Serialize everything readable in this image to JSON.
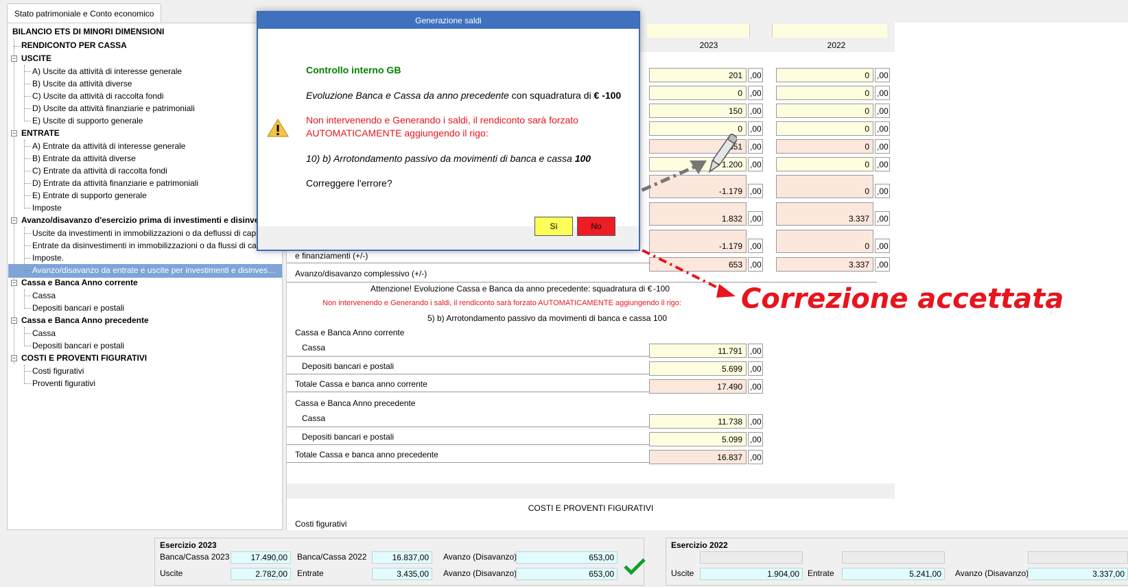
{
  "tab": {
    "label": "Stato patrimoniale e Conto economico"
  },
  "tree": {
    "root": "BILANCIO ETS DI MINORI DIMENSIONI",
    "rendiconto": "RENDICONTO PER CASSA",
    "uscite": "USCITE",
    "uscite_items": [
      "A) Uscite da attività di interesse generale",
      "B) Uscite da attività diverse",
      "C) Uscite da attività di raccolta fondi",
      "D) Uscite da attività finanziarie e patrimoniali",
      "E) Uscite di supporto generale"
    ],
    "entrate": "ENTRATE",
    "entrate_items": [
      "A) Entrate da attività di interesse generale",
      "B) Entrate da attività diverse",
      "C) Entrate da attività di raccolta fondi",
      "D) Entrate da attività finanziarie e patrimoniali",
      "E) Entrate di supporto generale",
      "Imposte"
    ],
    "avanzo": "Avanzo/disavanzo d'esercizio prima di investimenti e disinvestimenti",
    "avanzo_items": [
      "Uscite da investimenti in immobilizzazioni o da deflussi di capitale",
      "Entrate da disinvestimenti in immobilizzazioni o da flussi di capitale",
      "Imposte.",
      "Avanzo/disavanzo da entrate e uscite per investimenti e disinvestimenti"
    ],
    "cassa_corr": "Cassa e Banca Anno corrente",
    "cassa_corr_items": [
      "Cassa",
      "Depositi bancari e postali"
    ],
    "cassa_prec": "Cassa e Banca Anno precedente",
    "cassa_prec_items": [
      "Cassa",
      "Depositi bancari e postali"
    ],
    "costi": "COSTI E PROVENTI FIGURATIVI",
    "costi_items": [
      "Costi figurativi",
      "Proventi figurativi"
    ]
  },
  "main": {
    "year1": "2023",
    "year2": "2022",
    "dec": ",00",
    "rows_2023": [
      "201",
      "0",
      "150",
      "0",
      "351",
      "1.200",
      "-1.179",
      "1.832",
      "-1.179",
      "653"
    ],
    "rows_2022": [
      "0",
      "0",
      "0",
      "0",
      "0",
      "0",
      "0",
      "3.337",
      "0",
      "3.337"
    ],
    "label_fin": "e finanziamenti (+/-)",
    "label_avanzo": "Avanzo/disavanzo complessivo (+/-)",
    "warn1": "Attenzione! Evoluzione Cassa e Banca da anno precedente: squadratura di €",
    "warn1_val": "-100",
    "warn2": "Non intervenendo e Generando i saldi, il rendiconto sarà forzato AUTOMATICAMENTE aggiungendo il rigo:",
    "warn3": "5) b) Arrotondamento passivo da movimenti di banca e cassa",
    "warn3_val": "100",
    "cb_corr_title": "Cassa e Banca Anno corrente",
    "cassa_label": "Cassa",
    "depositi_label": "Depositi bancari e postali",
    "cb_corr_cassa": "11.791",
    "cb_corr_dep": "5.699",
    "tot_corr_label": "Totale Cassa e banca anno corrente",
    "tot_corr": "17.490",
    "cb_prec_title": "Cassa e Banca Anno precedente",
    "cb_prec_cassa": "11.738",
    "cb_prec_dep": "5.099",
    "tot_prec_label": "Totale Cassa e banca anno precedente",
    "tot_prec": "16.837",
    "costi_title": "COSTI E PROVENTI FIGURATIVI",
    "costi_fig": "Costi figurativi"
  },
  "dialog": {
    "title": "Generazione saldi",
    "heading": "Controllo interno GB",
    "line1": "Evoluzione Banca e Cassa da anno precedente",
    "line1b": "con squadratura di",
    "line1_val": "€ -100",
    "red": "Non intervenendo e Generando i saldi, il rendiconto sarà forzato AUTOMATICAMENTE aggiungendo il rigo:",
    "rigo": "10) b) Arrotondamento passivo da movimenti di banca e cassa",
    "rigo_val": "100",
    "question": "Correggere l'errore?",
    "yes": "Sì",
    "no": "No"
  },
  "annotation": "Correzione accettata",
  "footer": {
    "g1_title": "Esercizio 2023",
    "bc2023_label": "Banca/Cassa 2023",
    "bc2023": "17.490,00",
    "bc2022_label": "Banca/Cassa 2022",
    "bc2022": "16.837,00",
    "avanzo_label": "Avanzo (Disavanzo)",
    "avanzo1": "653,00",
    "avanzo2": "653,00",
    "uscite_label": "Uscite",
    "uscite": "2.782,00",
    "entrate_label": "Entrate",
    "entrate": "3.435,00",
    "g2_title": "Esercizio 2022",
    "uscite2": "1.904,00",
    "entrate2": "5.241,00",
    "avanzo3": "3.337,00"
  },
  "colors": {
    "dialog_title": "#3f71bf",
    "selected": "#7ea4d8",
    "annotation": "#e8141e",
    "heading": "#008000",
    "yes_btn": "#ffff5a",
    "no_btn": "#ee1c24"
  }
}
